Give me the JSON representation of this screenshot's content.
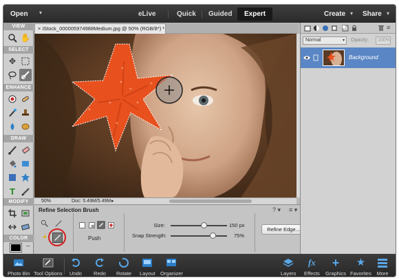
{
  "menubar": {
    "open": "Open",
    "modes": [
      "eLive",
      "Quick",
      "Guided",
      "Expert"
    ],
    "active_mode": "Expert",
    "create": "Create",
    "share": "Share"
  },
  "toolbox": {
    "sections": [
      "VIEW",
      "SELECT",
      "ENHANCE",
      "DRAW",
      "MODIFY",
      "COLOR"
    ]
  },
  "document": {
    "tab_title": "iStock_000005974988Medium.jpg @ 50% (RGB/8*)",
    "close": "×",
    "modified_marker": "*"
  },
  "status": {
    "zoom": "50%",
    "doc_info": "Doc: 5.49M/5.49M"
  },
  "tool_options": {
    "title": "Refine Selection Brush",
    "push_label": "Push",
    "size_label": "Size:",
    "size_value": "150 px",
    "size_fraction": 0.6,
    "snap_label": "Snap Strength:",
    "snap_value": "75%",
    "snap_fraction": 0.75,
    "refine_button": "Refine Edge..."
  },
  "layers": {
    "blend_mode": "Normal",
    "opacity_label": "Opacity:",
    "opacity_value": "100%",
    "items": [
      {
        "name": "Background"
      }
    ]
  },
  "bottombar": {
    "items": [
      "Photo Bin",
      "Tool Options",
      "Undo",
      "Redo",
      "Rotate",
      "Layout",
      "Organizer",
      "Layers",
      "Effects",
      "Graphics",
      "Favorites",
      "More"
    ]
  },
  "colors": {
    "layer_selected": "#5a86c5",
    "starfish": "#e8501e"
  }
}
